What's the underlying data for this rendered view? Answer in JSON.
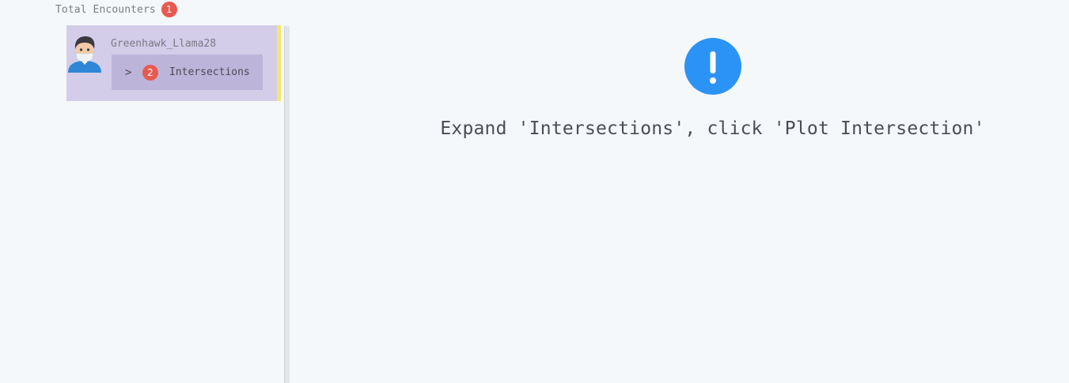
{
  "header": {
    "title": "Total Encounters",
    "count": "1"
  },
  "encounter": {
    "user_name": "Greenhawk_Llama28",
    "avatar_icon": "masked-person-avatar-icon",
    "section": {
      "chevron": ">",
      "step_number": "2",
      "label": "Intersections"
    }
  },
  "main": {
    "alert_icon": "exclamation-circle-icon",
    "alert_color": "#2b93f5",
    "instruction": "Expand 'Intersections', click 'Plot Intersection'"
  },
  "colors": {
    "badge": "#e85a50",
    "card_bg": "#d3cde9",
    "row_bg": "#bdb4d9",
    "accent": "#f0e86a"
  }
}
